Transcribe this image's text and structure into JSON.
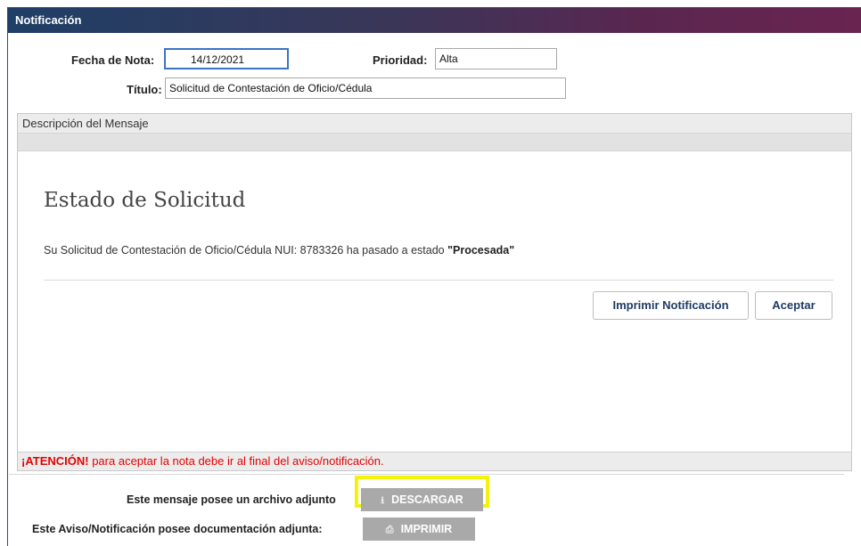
{
  "window": {
    "title": "Notificación"
  },
  "form": {
    "fecha_label": "Fecha de Nota:",
    "fecha_value": "14/12/2021",
    "prioridad_label": "Prioridad:",
    "prioridad_value": "Alta",
    "titulo_label": "Título:",
    "titulo_value": "Solicitud de Contestación de Oficio/Cédula"
  },
  "panel": {
    "header": "Descripción del Mensaje",
    "message_title": "Estado de Solicitud",
    "message_text": "Su Solicitud de Contestación de Oficio/Cédula NUI: 8783326 ha pasado a estado ",
    "message_status": "\"Procesada\"",
    "print_button": "Imprimir Notificación",
    "accept_button": "Aceptar",
    "warning_strong": "¡ATENCIÓN!",
    "warning_text": " para aceptar la nota debe ir al final del aviso/notificación."
  },
  "attachments": {
    "file_label": "Este mensaje posee un archivo adjunto",
    "download_button": "DESCARGAR",
    "doc_label": "Este Aviso/Notificación posee documentación adjunta:",
    "print_button": "IMPRIMIR"
  },
  "colors": {
    "warning": "#e60000",
    "highlight": "#f2f20a",
    "accent": "#3b74c4"
  }
}
